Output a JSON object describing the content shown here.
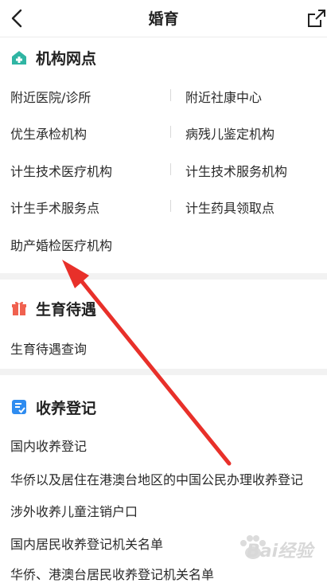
{
  "header": {
    "title": "婚育"
  },
  "sections": [
    {
      "title": "机构网点",
      "items": [
        "附近医院/诊所",
        "附近社康中心",
        "优生承检机构",
        "病残儿鉴定机构",
        "计生技术医疗机构",
        "计生技术服务机构",
        "计生手术服务点",
        "计生药具领取点",
        "助产婚检医疗机构"
      ]
    },
    {
      "title": "生育待遇",
      "items": [
        "生育待遇查询"
      ]
    },
    {
      "title": "收养登记",
      "items": [
        "国内收养登记",
        "华侨以及居住在港澳台地区的中国公民办理收养登记",
        "涉外收养儿童注销户口",
        "国内居民收养登记机关名单",
        "华侨、港澳台居民收养登记机关名单"
      ]
    }
  ],
  "watermark": {
    "text": "Bai经验"
  },
  "colors": {
    "arrow": "#e8302a",
    "icon_green": "#2fb5a3",
    "icon_red": "#f0614f",
    "icon_blue": "#2f8cf0"
  }
}
